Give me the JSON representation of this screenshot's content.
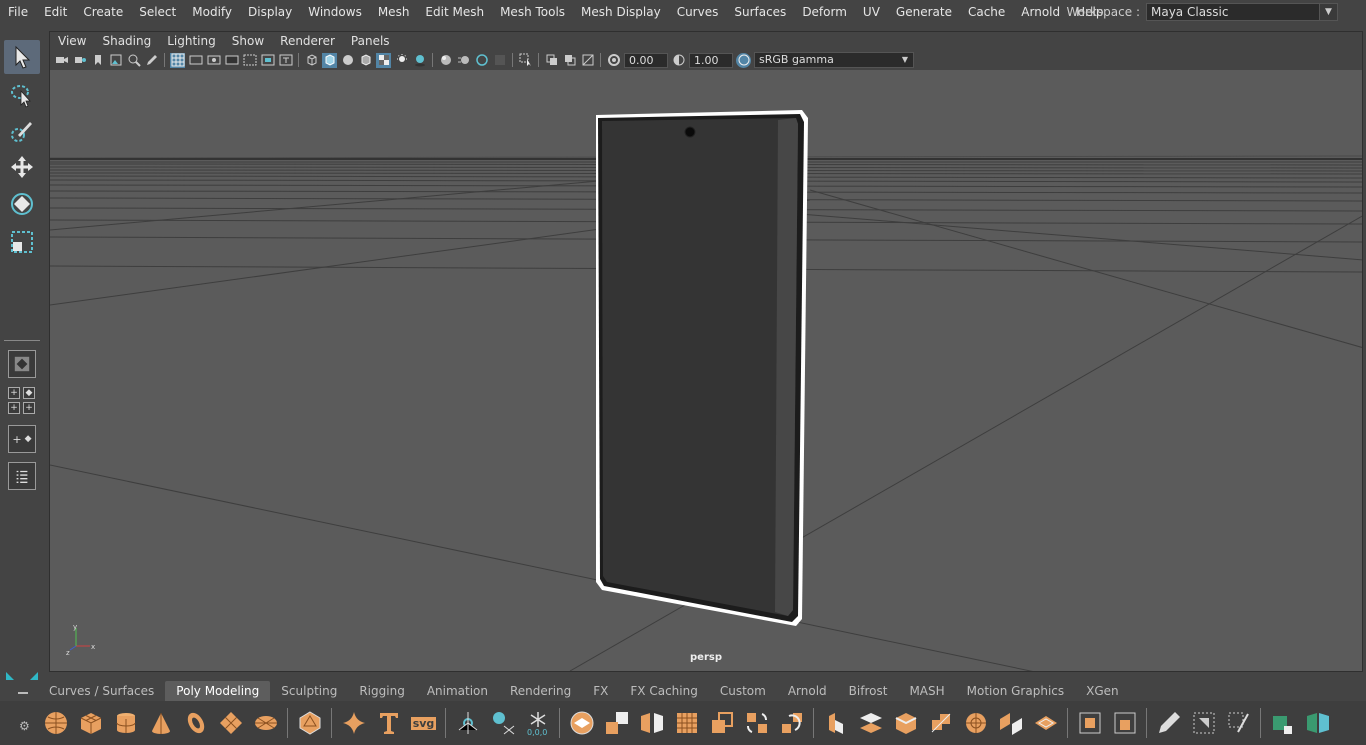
{
  "menubar": {
    "items": [
      "File",
      "Edit",
      "Create",
      "Select",
      "Modify",
      "Display",
      "Windows",
      "Mesh",
      "Edit Mesh",
      "Mesh Tools",
      "Mesh Display",
      "Curves",
      "Surfaces",
      "Deform",
      "UV",
      "Generate",
      "Cache",
      "Arnold",
      "Help"
    ]
  },
  "workspace": {
    "label": "Workspace :",
    "value": "Maya Classic"
  },
  "panel": {
    "menus": [
      "View",
      "Shading",
      "Lighting",
      "Show",
      "Renderer",
      "Panels"
    ],
    "exposure": "0.00",
    "gamma": "1.00",
    "colorspace": "sRGB gamma",
    "camera": "persp"
  },
  "shelf": {
    "tabs": [
      "Curves / Surfaces",
      "Poly Modeling",
      "Sculpting",
      "Rigging",
      "Animation",
      "Rendering",
      "FX",
      "FX Caching",
      "Custom",
      "Arnold",
      "Bifrost",
      "MASH",
      "Motion Graphics",
      "XGen"
    ],
    "active_tab": "Poly Modeling",
    "svg_label": "svg",
    "coord_label": "0,0,0"
  },
  "colors": {
    "accent": "#5285a6",
    "shelf_icon": "#e8a060",
    "viewport_bg": "#5b5b5b"
  }
}
